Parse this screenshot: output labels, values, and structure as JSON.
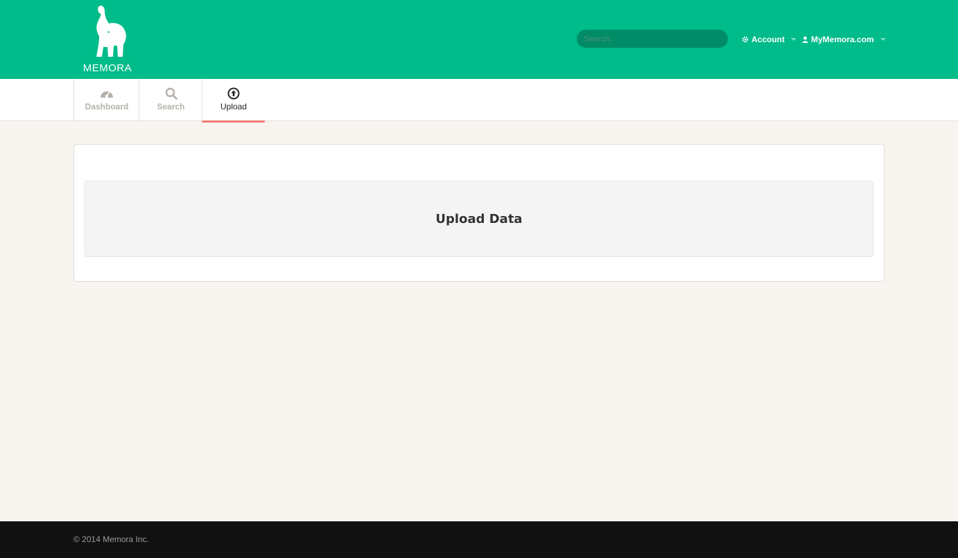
{
  "header": {
    "logo_text": "MEMORA",
    "search_placeholder": "Search",
    "account_label": "Account",
    "site_label": "MyMemora.com"
  },
  "tabs": [
    {
      "label": "Dashboard",
      "icon": "dashboard-icon",
      "active": false
    },
    {
      "label": "Search",
      "icon": "search-icon",
      "active": false
    },
    {
      "label": "Upload",
      "icon": "upload-circle-icon",
      "active": true
    }
  ],
  "main": {
    "upload_title": "Upload Data"
  },
  "footer": {
    "copyright": "© 2014 Memora Inc."
  },
  "colors": {
    "brand": "#00bb8a",
    "active_tab_accent": "#f07a6e",
    "footer_bg": "#111111"
  }
}
